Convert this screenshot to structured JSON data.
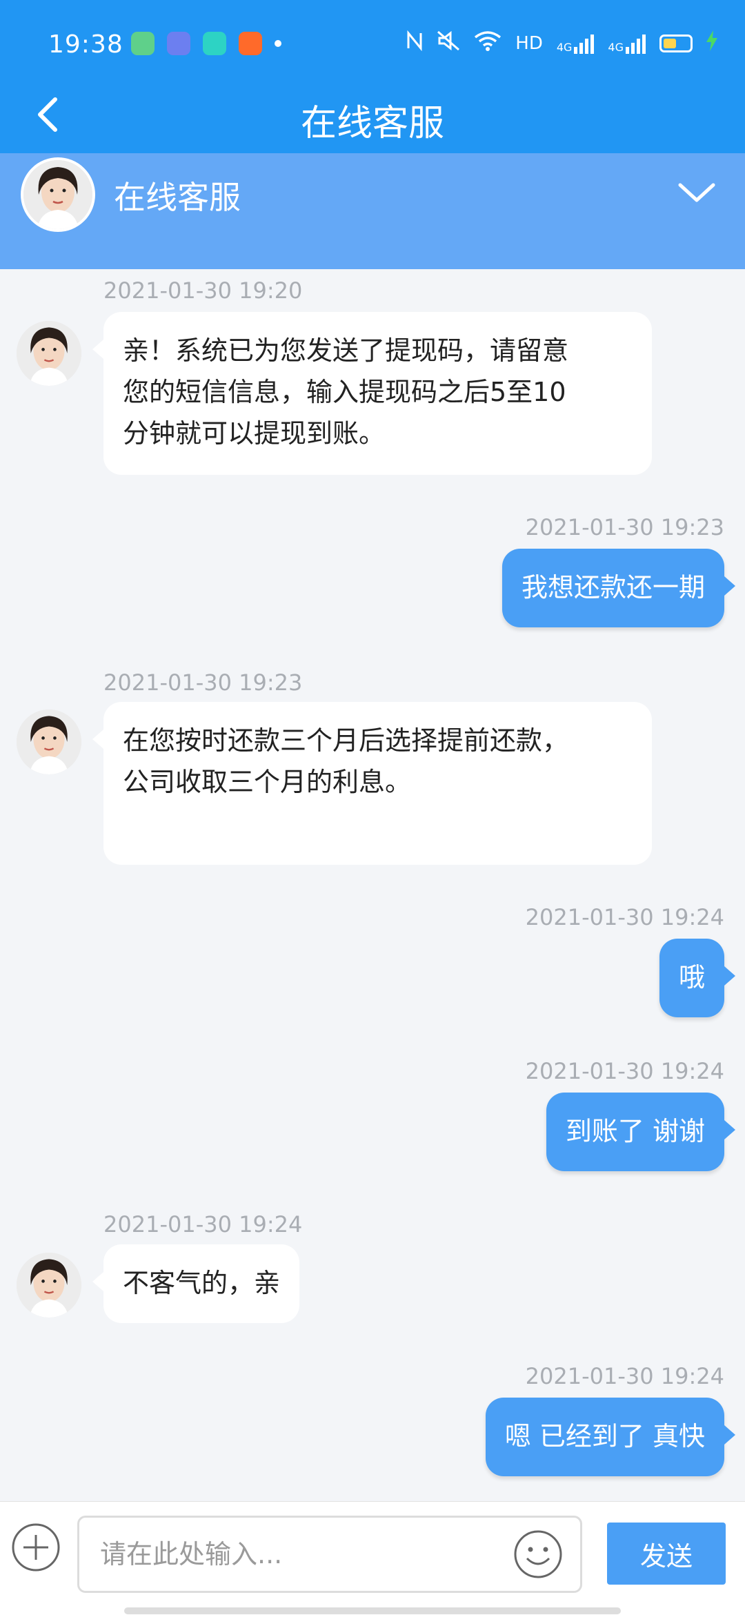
{
  "status_bar": {
    "time": "19:38",
    "network_label": "HD",
    "signal_label": "4G"
  },
  "header": {
    "title": "在线客服"
  },
  "agent": {
    "name": "在线客服"
  },
  "messages": [
    {
      "side": "agent",
      "time": "2021-01-30 19:20",
      "text": "亲！系统已为您发送了提现码，请留意\n您的短信信息，输入提现码之后5至10\n分钟就可以提现到账。"
    },
    {
      "side": "user",
      "time": "2021-01-30 19:23",
      "text": "我想还款还一期"
    },
    {
      "side": "agent",
      "time": "2021-01-30 19:23",
      "text": "在您按时还款三个月后选择提前还款，\n公司收取三个月的利息。"
    },
    {
      "side": "user",
      "time": "2021-01-30 19:24",
      "text": "哦"
    },
    {
      "side": "user",
      "time": "2021-01-30 19:24",
      "text": "到账了 谢谢"
    },
    {
      "side": "agent",
      "time": "2021-01-30 19:24",
      "text": "不客气的，亲"
    },
    {
      "side": "user",
      "time": "2021-01-30 19:24",
      "text": "嗯 已经到了 真快"
    }
  ],
  "input": {
    "placeholder": "请在此处输入...",
    "value": "",
    "send_label": "发送"
  },
  "colors": {
    "primary": "#2196f3",
    "agent_bar": "#64a8f6",
    "user_bubble": "#4a9ff5",
    "chat_bg": "#f3f5f8"
  }
}
